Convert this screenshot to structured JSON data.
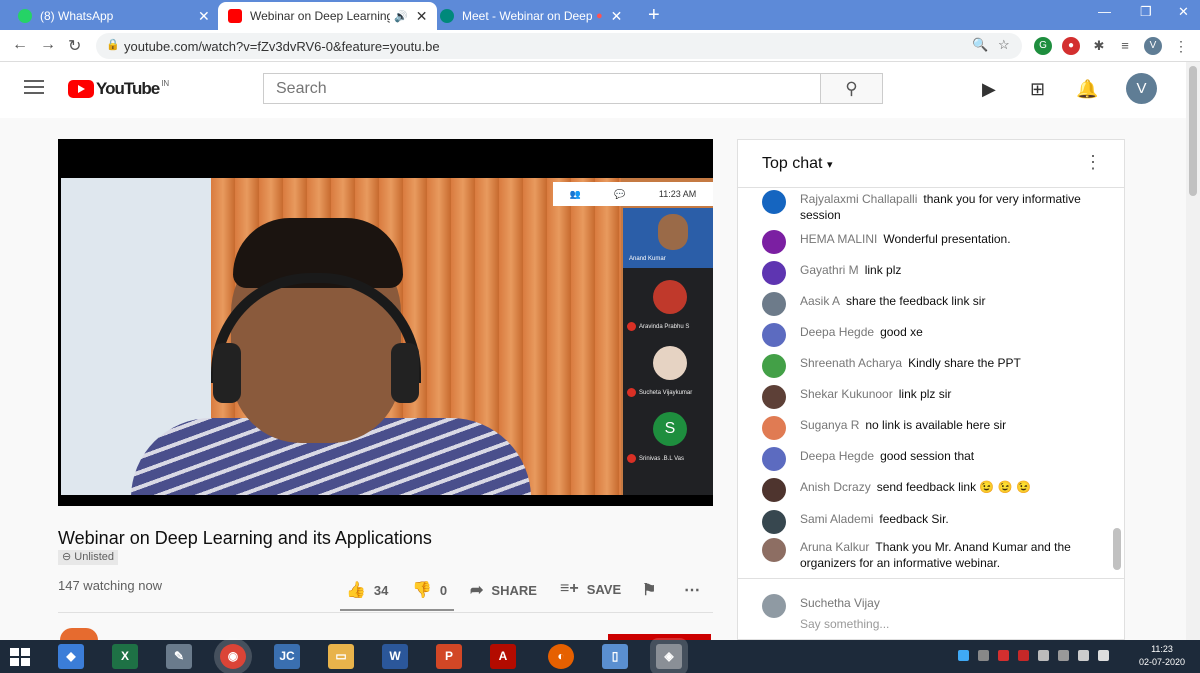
{
  "browser": {
    "tabs": [
      {
        "title": "(8) WhatsApp",
        "favicon_color": "#25d366",
        "active": false
      },
      {
        "title": "Webinar on Deep Learning a",
        "favicon_color": "#ff0000",
        "active": true
      },
      {
        "title": "Meet - Webinar on Deep Lo",
        "favicon_color": "#00897b",
        "active": false
      }
    ],
    "url": "youtube.com/watch?v=fZv3dvRV6-0&feature=youtu.be",
    "profile_initial": "V"
  },
  "youtube": {
    "logo_text": "YouTube",
    "region": "IN",
    "search_placeholder": "Search",
    "avatar_initial": "V"
  },
  "video": {
    "title": "Webinar on Deep Learning and its Applications",
    "visibility": "Unlisted",
    "watching": "147 watching now",
    "likes": "34",
    "dislikes": "0",
    "share_label": "SHARE",
    "save_label": "SAVE",
    "meet": {
      "time": "11:23 AM",
      "self_label": "Anand Kumar",
      "participants": [
        {
          "name": "Aravinda Prabhu S",
          "color": "#c0392b"
        },
        {
          "name": "Sucheta Vijaykumar",
          "color": "#e6d3c3"
        },
        {
          "name": "Srinivas .B.L Vas",
          "color": "#1e8e3e",
          "initial": "S"
        }
      ]
    }
  },
  "chat": {
    "title": "Top chat",
    "messages": [
      {
        "name": "Rajyalaxmi Challapalli",
        "text": "thank you for very informative session",
        "color": "#1565c0"
      },
      {
        "name": "HEMA MALINI",
        "text": "Wonderful presentation.",
        "color": "#7b1fa2"
      },
      {
        "name": "Gayathri M",
        "text": "link plz",
        "color": "#5e35b1"
      },
      {
        "name": "Aasik A",
        "text": "share the feedback link sir",
        "color": "#6d7b8a"
      },
      {
        "name": "Deepa Hegde",
        "text": "good xe",
        "color": "#5c6bc0"
      },
      {
        "name": "Shreenath Acharya",
        "text": "Kindly share the PPT",
        "color": "#43a047"
      },
      {
        "name": "Shekar Kukunoor",
        "text": "link plz sir",
        "color": "#5d4037"
      },
      {
        "name": "Suganya R",
        "text": "no link is available here sir",
        "color": "#e07b53"
      },
      {
        "name": "Deepa Hegde",
        "text": "good session that",
        "color": "#5c6bc0"
      },
      {
        "name": "Anish Dcrazy",
        "text": "send feedback link 😉 😉 😉",
        "color": "#4e342e"
      },
      {
        "name": "Sami Alademi",
        "text": "feedback Sir.",
        "color": "#37474f"
      },
      {
        "name": "Aruna Kalkur",
        "text": "Thank you Mr. Anand Kumar and the organizers for an informative webinar.",
        "color": "#8d6e63"
      }
    ],
    "input_user": "Suchetha Vijay",
    "input_placeholder": "Say something..."
  },
  "taskbar": {
    "time": "11:23",
    "date": "02-07-2020"
  }
}
